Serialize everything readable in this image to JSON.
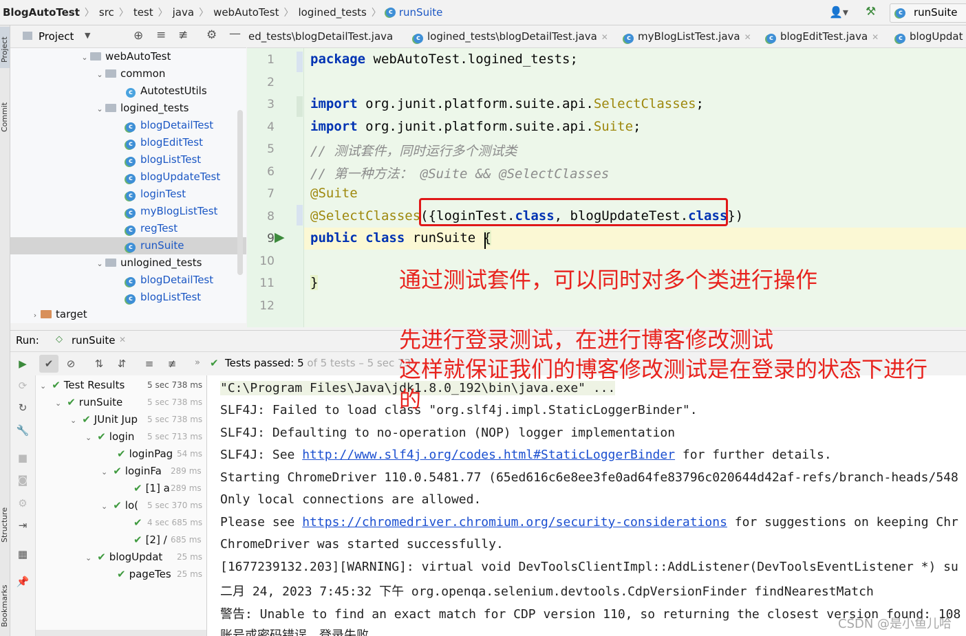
{
  "breadcrumb": {
    "items": [
      "BlogAutoTest",
      "src",
      "test",
      "java",
      "webAutoTest",
      "logined_tests",
      "runSuite"
    ]
  },
  "navbar": {
    "run_config": "runSuite"
  },
  "left_strip": {
    "labels": [
      "Project",
      "Commit",
      "Structure",
      "Bookmarks"
    ]
  },
  "project_panel": {
    "title": "Project",
    "tree": [
      {
        "label": "webAutoTest",
        "type": "folder"
      },
      {
        "label": "common",
        "type": "folder"
      },
      {
        "label": "AutotestUtils",
        "type": "class"
      },
      {
        "label": "logined_tests",
        "type": "folder"
      },
      {
        "label": "blogDetailTest",
        "type": "test"
      },
      {
        "label": "blogEditTest",
        "type": "test"
      },
      {
        "label": "blogListTest",
        "type": "test"
      },
      {
        "label": "blogUpdateTest",
        "type": "test"
      },
      {
        "label": "loginTest",
        "type": "test"
      },
      {
        "label": "myBlogListTest",
        "type": "test"
      },
      {
        "label": "regTest",
        "type": "test"
      },
      {
        "label": "runSuite",
        "type": "test"
      },
      {
        "label": "unlogined_tests",
        "type": "folder"
      },
      {
        "label": "blogDetailTest",
        "type": "test"
      },
      {
        "label": "blogListTest",
        "type": "test"
      },
      {
        "label": "target",
        "type": "folder"
      }
    ]
  },
  "editor_tabs": [
    "ed_tests\\blogDetailTest.java",
    "logined_tests\\blogDetailTest.java",
    "myBlogListTest.java",
    "blogEditTest.java",
    "blogUpdat"
  ],
  "code": {
    "line_numbers": [
      "1",
      "2",
      "3",
      "4",
      "5",
      "6",
      "7",
      "8",
      "9",
      "10",
      "11",
      "12"
    ],
    "package_kw": "package",
    "package_name": " webAutoTest.logined_tests;",
    "import_kw": "import",
    "import1_pkg": " org.junit.platform.suite.api.",
    "import1_cls": "SelectClasses",
    "import2_pkg": " org.junit.platform.suite.api.",
    "import2_cls": "Suite",
    "semicolon": ";",
    "comment1": "// 测试套件，同时运行多个测试类",
    "comment2": "// 第一种方法： @Suite && @SelectClasses",
    "annotation_suite": "@Suite",
    "annotation_select": "@SelectClasses",
    "select_open": "(",
    "select_brace_open": "{",
    "select_login": "loginTest.",
    "select_kw_class": "class",
    "select_comma": ", ",
    "select_update": "blogUpdateTest.",
    "select_brace_close": "}",
    "select_close": ")",
    "public_kw": "public",
    "class_kw": "class",
    "class_name": " runSuite ",
    "open_brace": "{",
    "close_brace": "}"
  },
  "annotations": {
    "note1": "通过测试套件，可以同时对多个类进行操作",
    "note2": "先进行登录测试，在进行博客修改测试",
    "note3": "这样就保证我们的博客修改测试是在登录的状态下进行",
    "note4": "的"
  },
  "run_panel": {
    "label": "Run:",
    "config": "runSuite",
    "status_prefix": "Tests passed:",
    "status_count": "5",
    "status_rest": "of 5 tests – 5 sec 73"
  },
  "test_tree": [
    {
      "label": "Test Results",
      "time": "5 sec 738 ms"
    },
    {
      "label": "runSuite",
      "time": "5 sec 738 ms"
    },
    {
      "label": "JUnit Jup",
      "time": "5 sec 738 ms"
    },
    {
      "label": "login",
      "time": "5 sec 713 ms"
    },
    {
      "label": "loginPag",
      "time": "54 ms"
    },
    {
      "label": "loginFa",
      "time": "289 ms"
    },
    {
      "label": "[1] a",
      "time": "289 ms"
    },
    {
      "label": "lo(",
      "time": "5 sec 370 ms"
    },
    {
      "label": "",
      "time": "4 sec 685 ms"
    },
    {
      "label": "[2] /",
      "time": "685 ms"
    },
    {
      "label": "blogUpdat",
      "time": "25 ms"
    },
    {
      "label": "pageTes",
      "time": "25 ms"
    }
  ],
  "console": [
    "\"C:\\Program Files\\Java\\jdk1.8.0_192\\bin\\java.exe\" ...",
    "SLF4J: Failed to load class \"org.slf4j.impl.StaticLoggerBinder\".",
    "SLF4J: Defaulting to no-operation (NOP) logger implementation",
    "SLF4J: See ",
    "http://www.slf4j.org/codes.html#StaticLoggerBinder",
    " for further details.",
    "Starting ChromeDriver 110.0.5481.77 (65ed616c6e8ee3fe0ad64fe83796c020644d42af-refs/branch-heads/548",
    "Only local connections are allowed.",
    "Please see ",
    "https://chromedriver.chromium.org/security-considerations",
    " for suggestions on keeping Chr",
    "ChromeDriver was started successfully.",
    "[1677239132.203][WARNING]: virtual void DevToolsClientImpl::AddListener(DevToolsEventListener *) su",
    "二月 24, 2023 7:45:32 下午 org.openqa.selenium.devtools.CdpVersionFinder findNearestMatch",
    "警告: Unable to find an exact match for CDP version 110, so returning the closest version found: 108",
    "账号或密码错误，登录失败"
  ],
  "watermark": "CSDN @是小鱼儿哈",
  "colors": {
    "accent_red": "#e01818",
    "editor_bg": "#edf7ea",
    "keyword": "#0033b3"
  }
}
